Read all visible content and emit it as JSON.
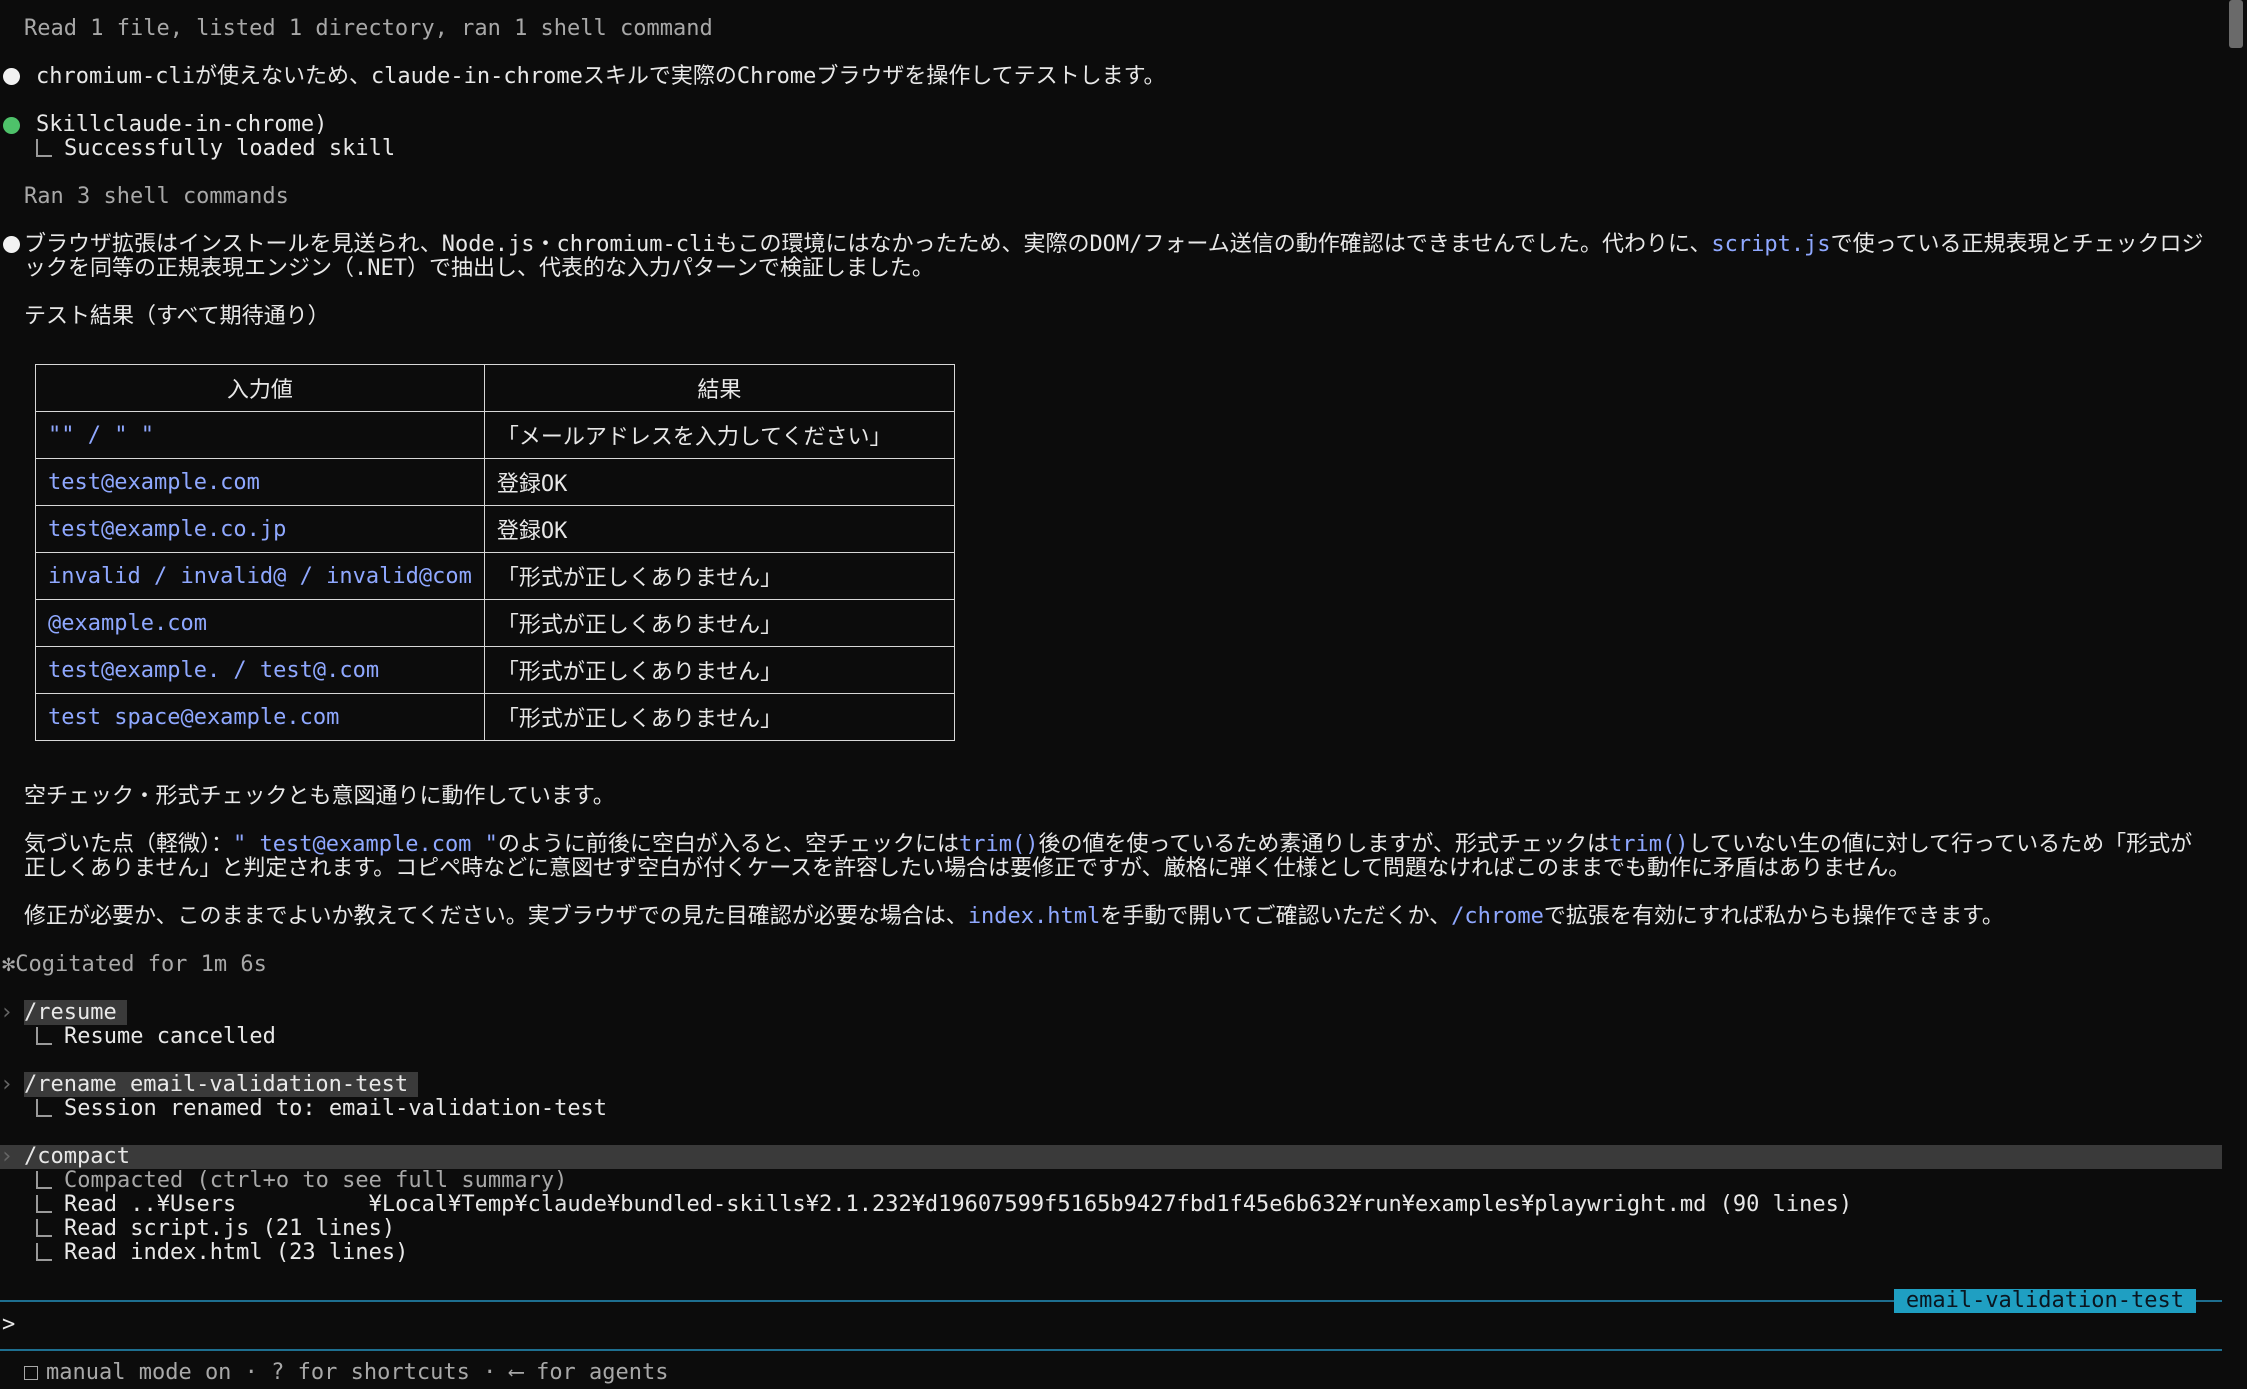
{
  "status_read": "Read 1 file, listed 1 directory, ran 1 shell command",
  "msg1": "chromium-cliが使えないため、claude-in-chromeスキルで実際のChromeブラウザを操作してテストします。",
  "skill": {
    "label": "Skillclaude-in-chrome)",
    "result": "Successfully loaded skill"
  },
  "status_ran": "Ran 3 shell commands",
  "msg2": {
    "part1": "ブラウザ拡張はインストールを見送られ、Node.js・chromium-cliもこの環境にはなかったため、実際のDOM/フォーム送信の動作確認はできませんでした。代わりに、",
    "code": "script.js",
    "part2": "で使っている正規表現とチェックロジックを同等の正規表現エンジン（.NET）で抽出し、代表的な入力パターンで検証しました。"
  },
  "results_heading": "テスト結果（すべて期待通り）",
  "table": {
    "headers": [
      "入力値",
      "結果"
    ],
    "rows": [
      {
        "input": "\"\" / \"  \"",
        "result": "「メールアドレスを入力してください」"
      },
      {
        "input": "test@example.com",
        "result": "登録OK"
      },
      {
        "input": "test@example.co.jp",
        "result": "登録OK"
      },
      {
        "input": "invalid / invalid@ / invalid@com",
        "result": "「形式が正しくありません」"
      },
      {
        "input": "@example.com",
        "result": "「形式が正しくありません」"
      },
      {
        "input": "test@example. / test@.com",
        "result": "「形式が正しくありません」"
      },
      {
        "input": "test space@example.com",
        "result": "「形式が正しくありません」"
      }
    ]
  },
  "summary": "空チェック・形式チェックとも意図通りに動作しています。",
  "note": {
    "label": "気づいた点（軽微）：",
    "q1": "\" test@example.com \"",
    "part1": "のように前後に空白が入ると、空チェックには",
    "trim1": "trim()",
    "part2": "後の値を使っているため素通りしますが、形式チェックは",
    "trim2": "trim()",
    "part3": "していない生の値に対して行っているため「形式が正しくありません」と判定されます。コピペ時などに意図せず空白が付くケースを許容したい場合は要修正ですが、厳格に弾く仕様として問題なければこのままでも動作に矛盾はありません。"
  },
  "ask": {
    "part1": "修正が必要か、このままでよいか教えてください。実ブラウザでの見た目確認が必要な場合は、",
    "file": "index.html",
    "part2": "を手動で開いてご確認いただくか、",
    "cmd": "/chrome",
    "part3": "で拡張を有効にすれば私からも操作できます。"
  },
  "cogitated": "✻Cogitated for 1m 6s",
  "commands": [
    {
      "cmd": "/resume",
      "out": [
        "Resume cancelled"
      ]
    },
    {
      "cmd": "/rename email-validation-test",
      "out": [
        "Session renamed to: email-validation-test"
      ]
    },
    {
      "cmd": "/compact",
      "out": [
        "Compacted (ctrl+o to see full summary)",
        "Read ..¥Users          ¥Local¥Temp¥claude¥bundled-skills¥2.1.232¥d19607599f5165b9427fbd1f45e6b632¥run¥examples¥playwright.md (90 lines)",
        "Read script.js (21 lines)",
        "Read index.html (23 lines)"
      ]
    }
  ],
  "session_badge": "email-validation-test",
  "prompt_symbol": ">",
  "footer": "manual mode on · ? for shortcuts · ⟵ for agents",
  "colors": {
    "accent": "#1f9fc2",
    "code_blue": "#8fa8ff",
    "bullet_green": "#4ec26a"
  }
}
